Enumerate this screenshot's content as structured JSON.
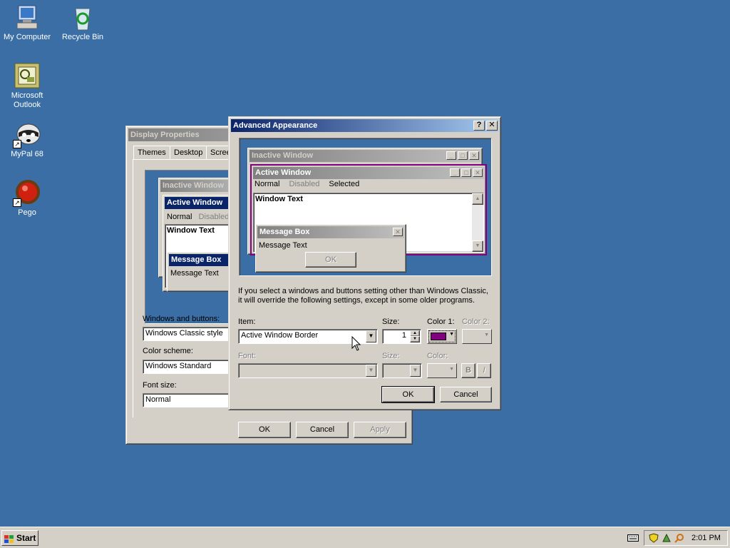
{
  "desktop": {
    "icons": [
      {
        "label": "My Computer"
      },
      {
        "label": "Recycle Bin"
      },
      {
        "label": "Microsoft Outlook"
      },
      {
        "label": "MyPal 68"
      },
      {
        "label": "Pego"
      }
    ]
  },
  "display_properties": {
    "title": "Display Properties",
    "tabs": [
      "Themes",
      "Desktop",
      "Scree"
    ],
    "preview": {
      "inactive_title": "Inactive Window",
      "active_title": "Active Window",
      "menu_normal": "Normal",
      "menu_disabled": "Disabled",
      "window_text": "Window Text",
      "msgbox_title": "Message Box",
      "msgbox_text": "Message Text"
    },
    "windows_buttons_label": "Windows and buttons:",
    "windows_buttons_value": "Windows Classic style",
    "color_scheme_label": "Color scheme:",
    "color_scheme_value": "Windows Standard",
    "font_size_label": "Font size:",
    "font_size_value": "Normal",
    "ok": "OK",
    "cancel": "Cancel",
    "apply": "Apply"
  },
  "advanced": {
    "title": "Advanced Appearance",
    "help_btn": "?",
    "close_btn": "✕",
    "preview": {
      "inactive_title": "Inactive Window",
      "active_title": "Active Window",
      "menu_normal": "Normal",
      "menu_disabled": "Disabled",
      "menu_selected": "Selected",
      "window_text": "Window Text",
      "msgbox_title": "Message Box",
      "msgbox_text": "Message Text",
      "msgbox_ok": "OK"
    },
    "info_text_line1": "If you select a windows and buttons setting other than Windows Classic,",
    "info_text_line2": "it will override the following settings, except in some older programs.",
    "item_label": "Item:",
    "item_value": "Active Window Border",
    "size_label": "Size:",
    "size_value": "1",
    "color1_label": "Color 1:",
    "color1_value": "#800080",
    "color2_label": "Color 2:",
    "font_label": "Font:",
    "font_size_label": "Size:",
    "font_color_label": "Color:",
    "bold_btn": "B",
    "italic_btn": "I",
    "ok": "OK",
    "cancel": "Cancel"
  },
  "taskbar": {
    "start": "Start",
    "clock": "2:01 PM"
  }
}
